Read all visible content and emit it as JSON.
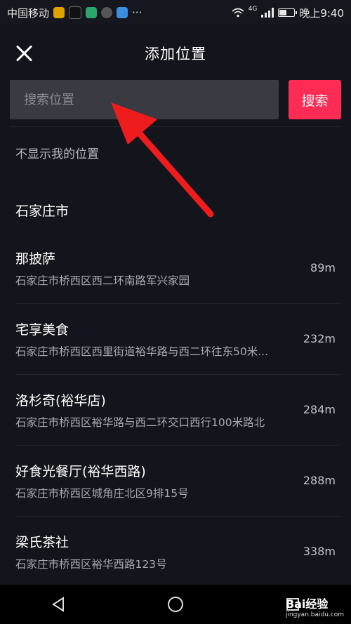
{
  "status_bar": {
    "carrier": "中国移动",
    "more": "···",
    "time": "晚上9:40",
    "network": "4G"
  },
  "header": {
    "title": "添加位置"
  },
  "search": {
    "placeholder": "搜索位置",
    "button_label": "搜索"
  },
  "no_location_label": "不显示我的位置",
  "city": "石家庄市",
  "places": [
    {
      "name": "那披萨",
      "address": "石家庄市桥西区西二环南路军兴家园",
      "distance": "89m"
    },
    {
      "name": "宅享美食",
      "address": "石家庄市桥西区西里街道裕华路与西二环往东50米...",
      "distance": "232m"
    },
    {
      "name": "洛杉奇(裕华店)",
      "address": "石家庄市桥西区裕华路与西二环交口西行100米路北",
      "distance": "284m"
    },
    {
      "name": "好食光餐厅(裕华西路)",
      "address": "石家庄市桥西区城角庄北区9排15号",
      "distance": "288m"
    },
    {
      "name": "梁氏茶社",
      "address": "石家庄市桥西区裕华西路123号",
      "distance": "338m"
    }
  ],
  "watermark": {
    "brand": "Bai经验",
    "url": "jingyan.baidu.com"
  },
  "colors": {
    "accent": "#fe2c55",
    "background": "#14141c",
    "annotation_arrow": "#ee1c1c"
  }
}
